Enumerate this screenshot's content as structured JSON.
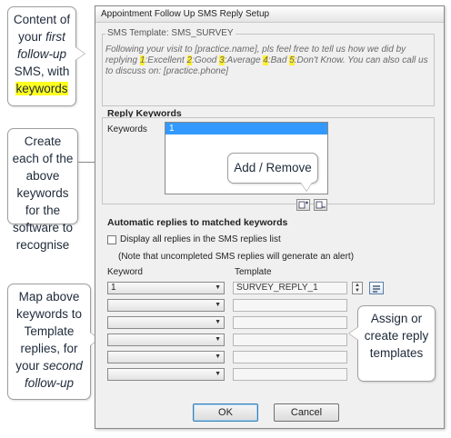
{
  "dialog": {
    "title": "Appointment Follow Up SMS Reply Setup",
    "template_label": "SMS Template:",
    "template_name": "SMS_SURVEY",
    "template_parts": [
      {
        "text": "Following your visit to [practice.name], pls feel free to tell us how we did by replying ",
        "hl": false
      },
      {
        "text": "1",
        "hl": true
      },
      {
        "text": ":Excellent ",
        "hl": false
      },
      {
        "text": "2",
        "hl": true
      },
      {
        "text": ":Good ",
        "hl": false
      },
      {
        "text": "3",
        "hl": true
      },
      {
        "text": ":Average ",
        "hl": false
      },
      {
        "text": "4",
        "hl": true
      },
      {
        "text": ":Bad ",
        "hl": false
      },
      {
        "text": "5",
        "hl": true
      },
      {
        "text": ":Don't Know.  You can also call us to discuss on: [practice.phone]",
        "hl": false
      }
    ],
    "reply_keywords_title": "Reply Keywords",
    "keywords_label": "Keywords",
    "keywords": [
      "1"
    ],
    "auto_replies_title": "Automatic replies to matched keywords",
    "display_all_label": "Display all replies in the SMS replies list",
    "display_all_checked": false,
    "note": "(Note that uncompleted SMS replies will generate an alert)",
    "col_keyword": "Keyword",
    "col_template": "Template",
    "rows": [
      {
        "keyword": "1",
        "template": "SURVEY_REPLY_1"
      },
      {
        "keyword": "",
        "template": ""
      },
      {
        "keyword": "",
        "template": ""
      },
      {
        "keyword": "",
        "template": ""
      },
      {
        "keyword": "",
        "template": ""
      },
      {
        "keyword": "",
        "template": ""
      }
    ],
    "ok_label": "OK",
    "cancel_label": "Cancel"
  },
  "callouts": {
    "c1_a": "Content of your ",
    "c1_b": "first follow-up",
    "c1_c": " SMS, with ",
    "c1_d": "keywords",
    "c2": "Create each of the above keywords for the software to recognise",
    "c3_a": "Map above keywords to Template replies, for your ",
    "c3_b": "second follow-up",
    "c4": "Add / Remove",
    "c5": "Assign or create reply templates"
  },
  "colors": {
    "highlight": "#ffff22",
    "selection": "#3399ff",
    "dialog_bg": "#f0f0f0"
  }
}
